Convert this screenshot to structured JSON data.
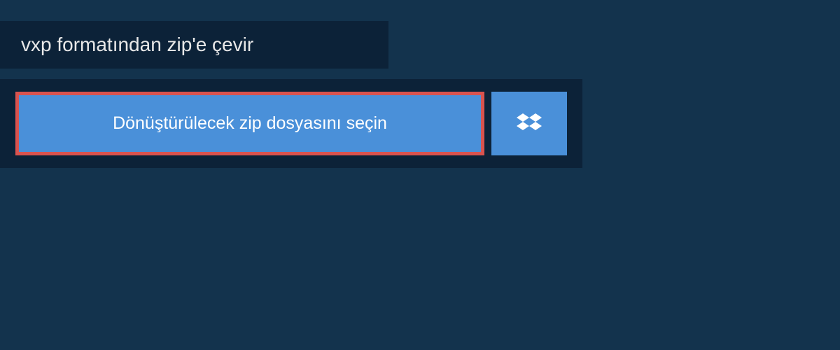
{
  "header": {
    "title": "vxp formatından zip'e çevir"
  },
  "upload": {
    "select_file_label": "Dönüştürülecek zip dosyasını seçin"
  }
}
